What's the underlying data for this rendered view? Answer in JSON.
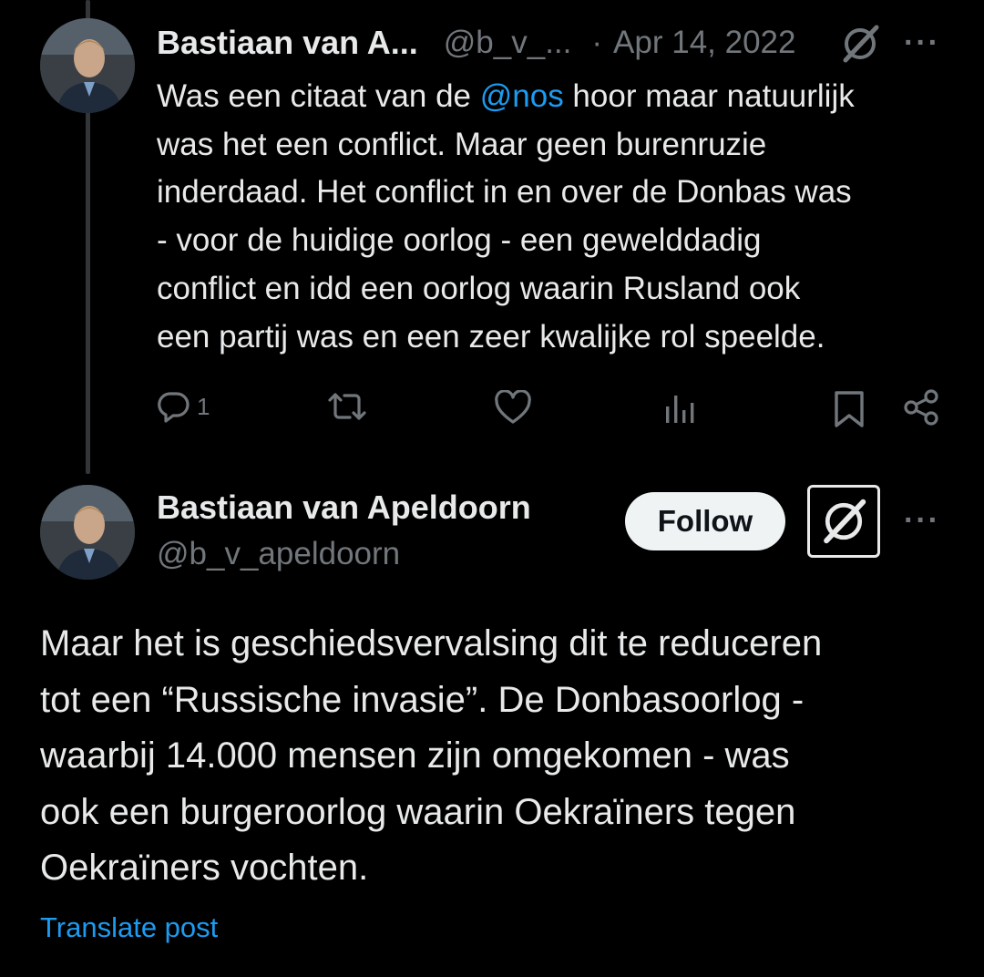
{
  "reply": {
    "author_name": "Bastiaan van A...",
    "author_handle": "@b_v_...",
    "separator": "·",
    "date": "Apr 14, 2022",
    "more_label": "···",
    "mention": "@nos",
    "text_before_mention": "Was een citaat van de ",
    "text_after_mention": " hoor maar natuurlijk",
    "lines": [
      "was het een conflict. Maar  geen burenruzie",
      "inderdaad. Het conflict in en over de Donbas was",
      "- voor de huidige oorlog - een gewelddadig",
      "conflict en idd een oorlog waarin Rusland ook",
      "een partij was en een zeer kwalijke rol speelde."
    ],
    "actions": {
      "reply_icon": "reply-icon",
      "reply_count": "1",
      "repost_icon": "repost-icon",
      "like_icon": "heart-icon",
      "views_icon": "views-icon",
      "bookmark_icon": "bookmark-icon",
      "share_icon": "share-icon"
    }
  },
  "main": {
    "author_name": "Bastiaan van Apeldoorn",
    "author_handle": "@b_v_apeldoorn",
    "follow_label": "Follow",
    "more_label": "···",
    "lines": [
      "Maar het is geschiedsvervalsing dit te reduceren",
      "tot een “Russische invasie”. De Donbasoorlog -",
      "waarbij 14.000 mensen zijn omgekomen - was",
      "ook een burgeroorlog waarin Oekraïners tegen",
      "Oekraïners vochten."
    ],
    "translate_label": "Translate post"
  },
  "colors": {
    "background": "#000000",
    "text": "#e7e9ea",
    "secondary": "#71767b",
    "accent": "#1d9bf0"
  }
}
